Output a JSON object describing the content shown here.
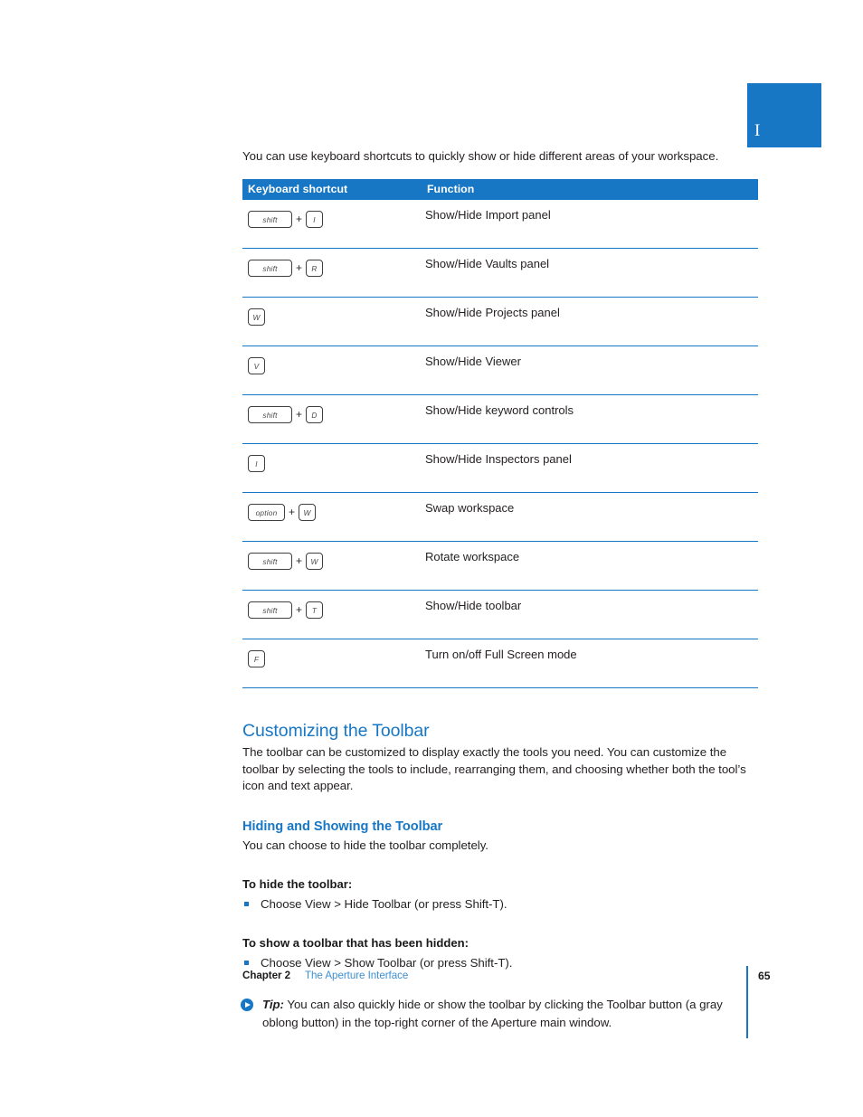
{
  "chapter_tab": {
    "numeral": "I"
  },
  "intro": {
    "paragraph": "You can use keyboard shortcuts to quickly show or hide different areas of your workspace."
  },
  "table": {
    "headers": {
      "shortcut": "Keyboard shortcut",
      "function": "Function"
    },
    "plus_symbol": "+",
    "rows": [
      {
        "modifier": "shift",
        "key": "I",
        "function": "Show/Hide Import panel"
      },
      {
        "modifier": "shift",
        "key": "R",
        "function": "Show/Hide Vaults panel"
      },
      {
        "modifier": "",
        "key": "W",
        "function": "Show/Hide Projects panel"
      },
      {
        "modifier": "",
        "key": "V",
        "function": "Show/Hide Viewer"
      },
      {
        "modifier": "shift",
        "key": "D",
        "function": "Show/Hide keyword controls"
      },
      {
        "modifier": "",
        "key": "I",
        "function": "Show/Hide Inspectors panel"
      },
      {
        "modifier": "option",
        "key": "W",
        "function": "Swap workspace"
      },
      {
        "modifier": "shift",
        "key": "W",
        "function": "Rotate workspace"
      },
      {
        "modifier": "shift",
        "key": "T",
        "function": "Show/Hide toolbar"
      },
      {
        "modifier": "",
        "key": "F",
        "function": "Turn on/off Full Screen mode"
      }
    ]
  },
  "section": {
    "heading": "Customizing the Toolbar",
    "paragraph": "The toolbar can be customized to display exactly the tools you need. You can customize the toolbar by selecting the tools to include, rearranging them, and choosing whether both the tool’s icon and text appear."
  },
  "subsection": {
    "heading": "Hiding and Showing the Toolbar",
    "paragraph": "You can choose to hide the toolbar completely.",
    "task_hide": {
      "heading": "To hide the toolbar:",
      "step": "Choose View > Hide Toolbar (or press Shift-T)."
    },
    "task_show": {
      "heading": "To show a toolbar that has been hidden:",
      "step": "Choose View > Show Toolbar (or press Shift-T)."
    }
  },
  "tip": {
    "label": "Tip:",
    "text": " You can also quickly hide or show the toolbar by clicking the Toolbar button (a gray oblong button) in the top-right corner of the Aperture main window."
  },
  "footer": {
    "chapter": "Chapter 2",
    "title": "The Aperture Interface",
    "page_number": "65"
  },
  "colors": {
    "brand_blue": "#1777c4",
    "link_blue": "#3d8fd0",
    "body_text": "#231f20"
  }
}
